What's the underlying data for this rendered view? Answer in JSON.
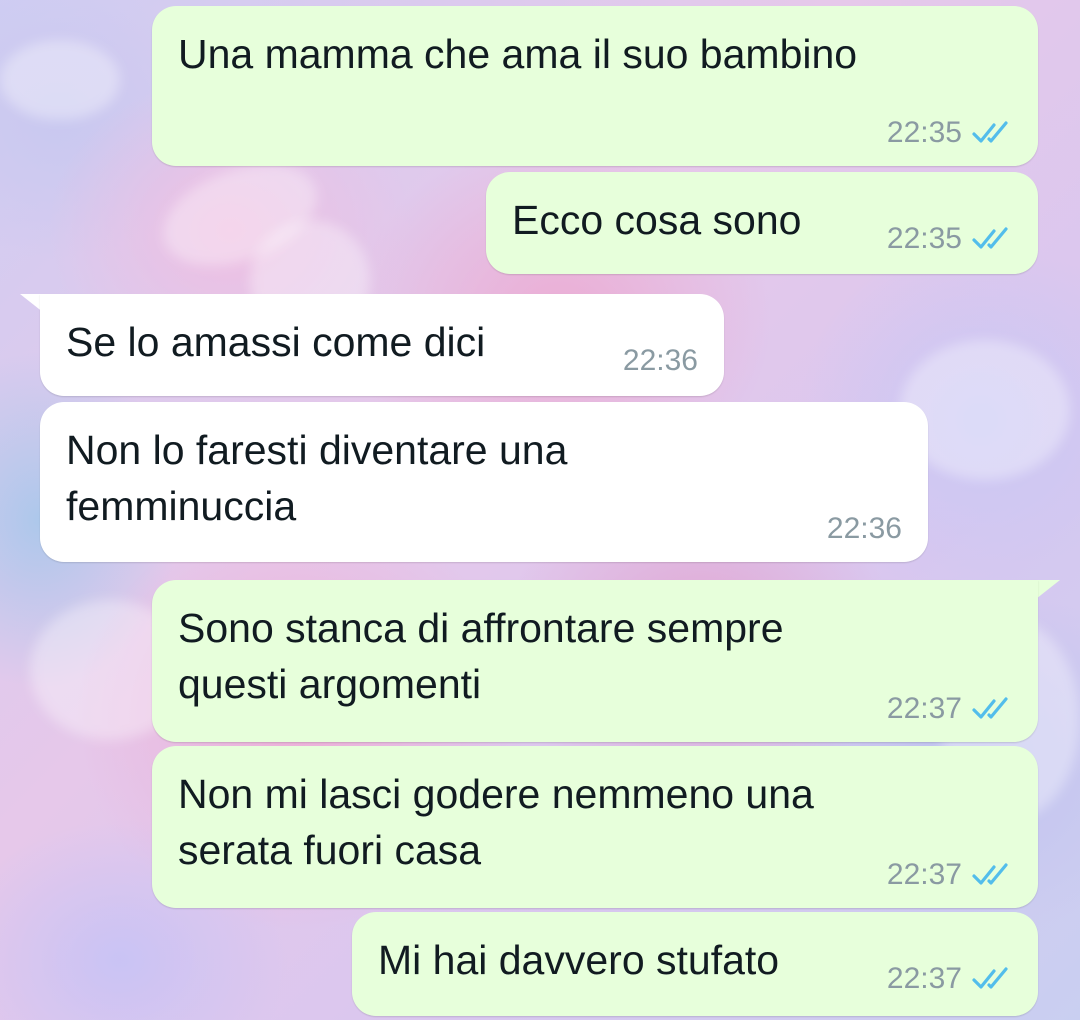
{
  "chat": {
    "messages": [
      {
        "id": "m1",
        "direction": "outgoing",
        "text": "Una mamma che ama il suo bambino",
        "time": "22:35",
        "status": "read"
      },
      {
        "id": "m2",
        "direction": "outgoing",
        "text": "Ecco cosa sono",
        "time": "22:35",
        "status": "read"
      },
      {
        "id": "m3",
        "direction": "incoming",
        "text": "Se lo amassi come dici",
        "time": "22:36"
      },
      {
        "id": "m4",
        "direction": "incoming",
        "text": "Non lo faresti diventare una\nfemminuccia",
        "time": "22:36"
      },
      {
        "id": "m5",
        "direction": "outgoing",
        "text": "Sono stanca di affrontare sempre\nquesti argomenti",
        "time": "22:37",
        "status": "read"
      },
      {
        "id": "m6",
        "direction": "outgoing",
        "text": "Non mi lasci godere nemmeno una\nserata fuori casa",
        "time": "22:37",
        "status": "read"
      },
      {
        "id": "m7",
        "direction": "outgoing",
        "text": "Mi hai davvero stufato",
        "time": "22:37",
        "status": "read"
      }
    ]
  },
  "colors": {
    "outgoing_bubble": "#e7ffdb",
    "incoming_bubble": "#ffffff",
    "read_ticks": "#53bdeb",
    "timestamp": "#8a9aa2"
  },
  "icons": {
    "read_receipt": "double-check-icon"
  }
}
